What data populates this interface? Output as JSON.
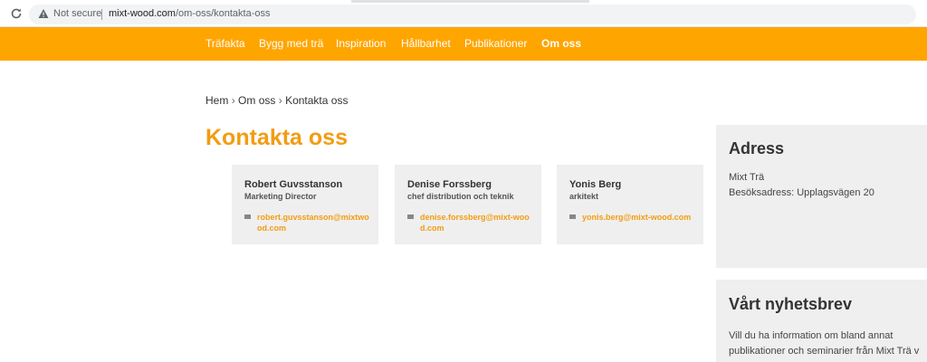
{
  "browser": {
    "security_label": "Not secure",
    "url_host": "mixt-wood.com",
    "url_path": "/om-oss/kontakta-oss"
  },
  "nav": {
    "items": [
      {
        "label": "Träfakta"
      },
      {
        "label": "Bygg med trä"
      },
      {
        "label": "Inspiration"
      },
      {
        "label": "Hållbarhet"
      },
      {
        "label": "Publikationer"
      },
      {
        "label": "Om oss"
      }
    ]
  },
  "breadcrumb": {
    "home": "Hem",
    "parent": "Om oss",
    "current": "Kontakta oss",
    "separator": "›"
  },
  "page": {
    "title": "Kontakta oss"
  },
  "contacts": [
    {
      "name": "Robert Guvsstanson",
      "role": "Marketing Director",
      "email": "robert.guvsstanson@mixtwood.com"
    },
    {
      "name": "Denise Forssberg",
      "role": "chef distribution och teknik",
      "email": "denise.forssberg@mixt-wood.com"
    },
    {
      "name": "Yonis Berg",
      "role": "arkitekt",
      "email": "yonis.berg@mixt-wood.com"
    }
  ],
  "address": {
    "heading": "Adress",
    "company": "Mixt Trä",
    "visit": "Besöksadress: Upplagsvägen 20"
  },
  "newsletter": {
    "heading": "Vårt nyhetsbrev",
    "line1": "Vill du ha information om bland annat",
    "line2": "publikationer och seminarier från Mixt Trä v"
  },
  "colors": {
    "accent": "#ffa500",
    "title": "#f39c12",
    "card_bg": "#efefef"
  }
}
